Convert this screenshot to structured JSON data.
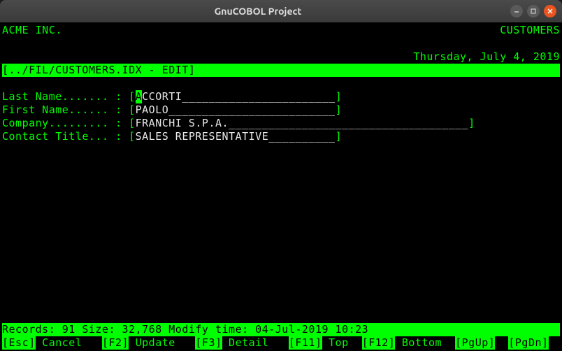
{
  "window": {
    "title": "GnuCOBOL Project"
  },
  "header": {
    "company": "ACME INC.",
    "module": "CUSTOMERS",
    "date": "Thursday, July 4, 2019"
  },
  "file_title": "[../FIL/CUSTOMERS.IDX - EDIT]",
  "fields": {
    "last_name": {
      "label": "Last Name....... : ",
      "cursor_char": "A",
      "rest": "CCORTI",
      "pad": "_______________________"
    },
    "first_name": {
      "label": "First Name...... : ",
      "value": "PAOLO",
      "pad": "_________________________"
    },
    "company": {
      "label": "Company......... : ",
      "value": "FRANCHI S.P.A.",
      "pad": "____________________________________"
    },
    "contact_title": {
      "label": "Contact Title... : ",
      "value": "SALES REPRESENTATIVE",
      "pad": "__________"
    }
  },
  "status_line": "Records: 91 Size: 32,768 Modify time: 04-Jul-2019 10:23",
  "keys": {
    "esc": "[Esc]",
    "esc_label": " Cancel   ",
    "f2": "[F2]",
    "f2_label": " Update   ",
    "f3": "[F3]",
    "f3_label": " Detail   ",
    "f11": "[F11]",
    "f11_label": " Top  ",
    "f12": "[F12]",
    "f12_label": " Bottom  ",
    "pgup": "[PgUp]",
    "pgup_label": "  ",
    "pgdn": "[PgDn]"
  }
}
